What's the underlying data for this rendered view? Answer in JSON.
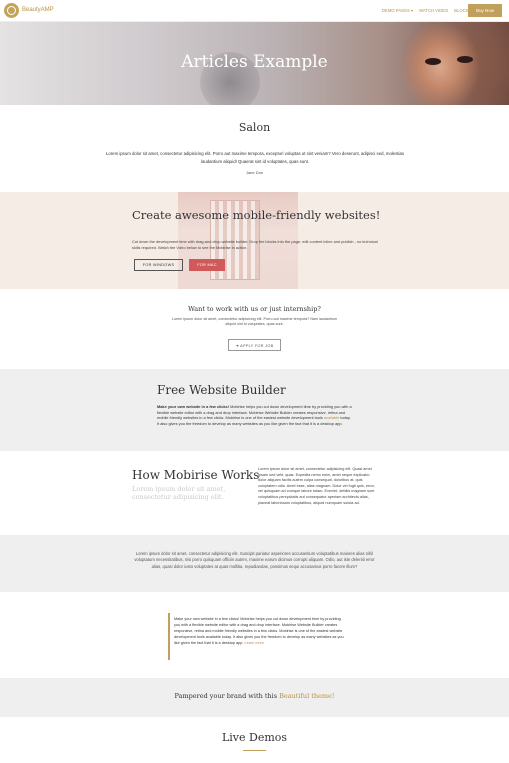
{
  "nav": {
    "brand": "BeautyAMP",
    "links": [
      "DEMO PAGES ▾",
      "WATCH VIDEO",
      "BLOCKS ▾"
    ],
    "buy_label": "Buy Now"
  },
  "hero": {
    "title": "Articles Example"
  },
  "salon": {
    "title": "Salon",
    "text": "Lorem ipsum dolor sit amet, consectetur adipisicing elit. Porro aut maxime tempora, excepturi voluptas ut sint veniam? Vero deserunt, adipisci sed, molestias laudantium aliquid! Quaerat sint id voluptates, quas sunt.",
    "author": "Jane Doe"
  },
  "create": {
    "title": "Create awesome mobile-friendly websites!",
    "text": "Cut down the development time with drag-and-drop website builder. Drop the blocks into the page, edit content inline and publish - no technical skills required. Watch the Vdeo below to see the Mobirise in action.",
    "btn_windows": "FOR WINDOWS",
    "btn_mac": "FOR MAC"
  },
  "intern": {
    "title": "Want to work with us or just internship?",
    "text": "Lorem ipsum dolor sit amet, consectetur adipisicing elit. Porro aut maxime tempora? Nam laudantium aliquid sint id voluptates, quas sunt.",
    "btn_apply": "➜ APPLY FOR JOB"
  },
  "fwb": {
    "title": "Free Website Builder",
    "lead": "Make your own website in a few clicks!",
    "text": " Mobirise helps you cut down development time by providing you with a flexible website editor with a drag and drop interface. Mobirise Website Builder creates responsive, retina and mobile friendly websites in a few clicks. Mobirise is one of the easiest website development tools ",
    "link": "available",
    "text2": " today. It also gives you the freedom to develop as many websites as you like given the fact that it is a desktop app."
  },
  "how": {
    "title": "How Mobirise Works",
    "sub": "Lorem ipsum dolor sit amet, consectetur adipisicing elit.",
    "text": "Lorem ipsum dolor sit amet, consectetur adipisicing elit. Quasi amet ipsam sed velit, quas. Expedita nemo enim, amet neque explicabo dolor aliquam facilis autem culpa consequat, doloribus at, quis voluptatem odio. Amet esse, alias magnam. Dolor vel fugit quis, error, vel quisquam ad cumque labore totam. Eveniet, debitis magnam sunt voluptatibus perspiciatis aut consequatur aperiam architecto alias, placeat laboriosam voluptatibus, aliquid numquam soluta ad."
  },
  "gray2": {
    "text": "Lorem ipsum dolor sit amet, consectetur adipisicing elit. Suscipit pariatur asperiores accusantium voluptatibus maiores alias nihil voluptatum necessitatibus, nisi porro quisquam officiis autem, maxime earum dicimus corrupti aliquam. Odio, aut iste deleniti error alias, quasi dolor iusto voluptates at quas mollitia, repudiandae, possimus sequi accusamus porro facere illum?"
  },
  "quote": {
    "text": "Make your own website in a few clicks! Mobirise helps you cut down development time by providing you with a flexible website editor with a drag and drop interface. Mobirise Website Builder creates responsive, retina and mobile friendly websites in a few clicks. Mobirise is one of the easiest website development tools available today. It also gives you the freedom to develop as many websites as you like given the fact that it is a desktop app.",
    "link": "Learn more"
  },
  "pampered": {
    "text": "Pampered your brand with this ",
    "link": "Beautiful theme!"
  },
  "live": {
    "title": "Live Demos"
  },
  "colors": {
    "accent": "#c0a05a",
    "mac_button": "#d05a5a",
    "section_gray": "#efefef"
  }
}
